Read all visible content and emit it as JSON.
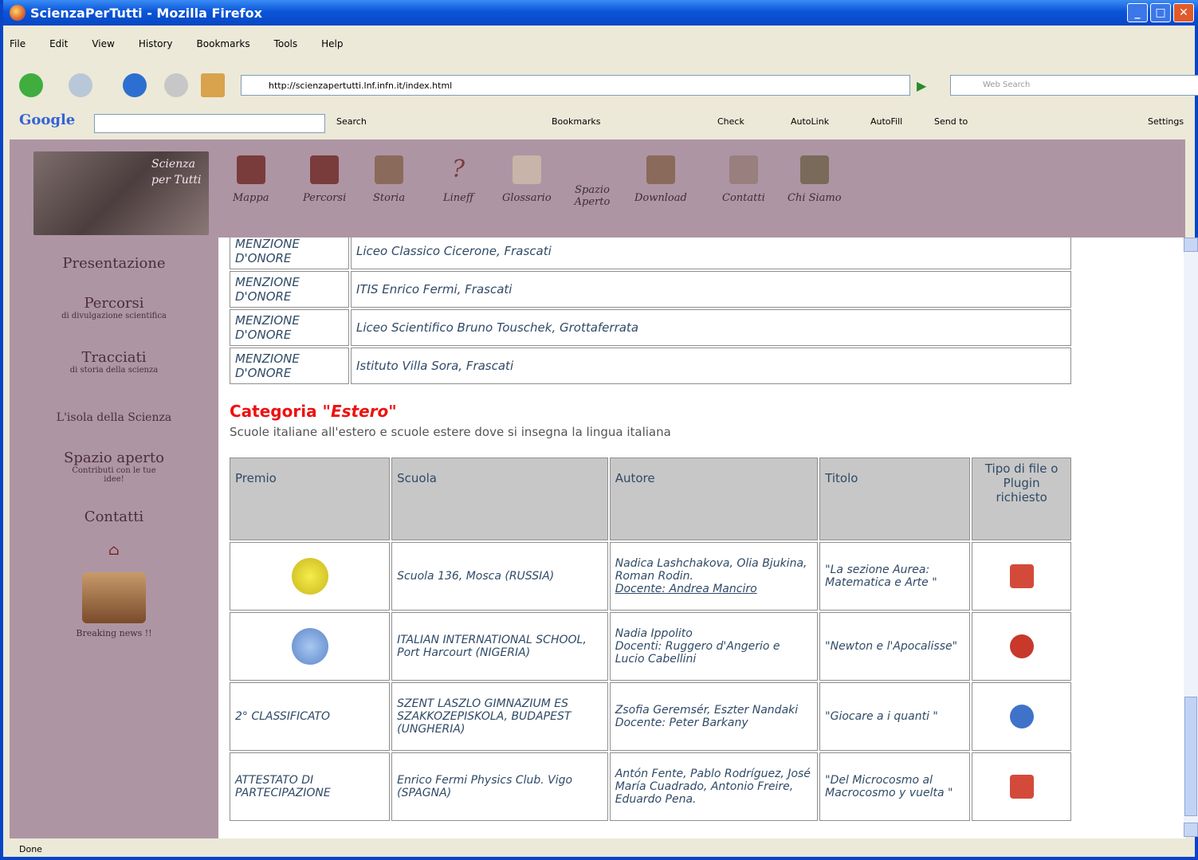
{
  "window": {
    "title": "ScienzaPerTutti - Mozilla Firefox"
  },
  "menu": [
    "File",
    "Edit",
    "View",
    "History",
    "Bookmarks",
    "Tools",
    "Help"
  ],
  "navbar": {
    "url": "http://scienzapertutti.lnf.infn.it/index.html",
    "search_placeholder": "Web Search"
  },
  "google_toolbar": {
    "logo": "Google",
    "search": "Search",
    "bookmarks": "Bookmarks",
    "check": "Check",
    "autolink": "AutoLink",
    "autofill": "AutoFill",
    "sendto": "Send to",
    "settings": "Settings"
  },
  "banner": {
    "logo_text_1": "Scienza",
    "logo_text_2": "per Tutti",
    "nav": [
      "Mappa",
      "Percorsi",
      "Storia",
      "Lineff",
      "Glossario",
      "Spazio Aperto",
      "Download",
      "Contatti",
      "Chi Siamo"
    ]
  },
  "sidebar": {
    "presentazione": "Presentazione",
    "percorsi": "Percorsi",
    "percorsi_sub": "di divulgazione scientifica",
    "tracciati": "Tracciati",
    "tracciati_sub": "di storia della scienza",
    "isola": "L'isola della Scienza",
    "spazio": "Spazio aperto",
    "spazio_sub": "Contributi con le tue idee!",
    "contatti": "Contatti",
    "breaking": "Breaking news !!"
  },
  "table1": [
    {
      "premio": "MENZIONE D'ONORE",
      "scuola": "Liceo Classico Cicerone, Frascati"
    },
    {
      "premio": "MENZIONE D'ONORE",
      "scuola": "ITIS Enrico Fermi, Frascati"
    },
    {
      "premio": "MENZIONE D'ONORE",
      "scuola": "Liceo Scientifico Bruno Touschek, Grottaferrata"
    },
    {
      "premio": "MENZIONE D'ONORE",
      "scuola": "Istituto Villa Sora, Frascati"
    }
  ],
  "category": {
    "title_prefix": "Categoria ",
    "title_quoted": "\"Estero\"",
    "subtitle": "Scuole italiane all'estero e scuole estere dove si insegna la lingua italiana"
  },
  "table2": {
    "headers": [
      "Premio",
      "Scuola",
      "Autore",
      "Titolo",
      "Tipo di file o Plugin richiesto"
    ],
    "rows": [
      {
        "premio": "",
        "scuola": "Scuola 136, Mosca (RUSSIA)",
        "autore": "Nadica Lashchakova, Olia Bjukina, Roman Rodin.",
        "docente": "Docente: Andrea Manciro",
        "titolo": "\"La sezione Aurea: Matematica e Arte \"",
        "file": "pdf"
      },
      {
        "premio": "",
        "scuola": "ITALIAN INTERNATIONAL SCHOOL, Port Harcourt (NIGERIA)",
        "autore": "Nadia Ippolito",
        "docente": "Docenti: Ruggero d'Angerio e Lucio Cabellini",
        "titolo": "\"Newton e l'Apocalisse\"",
        "file": "flash"
      },
      {
        "premio": "2° CLASSIFICATO",
        "scuola": "SZENT LASZLO GIMNAZIUM ES SZAKKOZEPISKOLA, BUDAPEST (UNGHERIA)",
        "autore": "Zsofia Geremsér, Eszter Nandaki",
        "docente": "Docente: Peter Barkany",
        "titolo": "\"Giocare a i quanti \"",
        "file": "ie"
      },
      {
        "premio": "ATTESTATO DI PARTECIPAZIONE",
        "scuola": "Enrico Fermi Physics Club. Vigo (SPAGNA)",
        "autore": "Antón Fente, Pablo Rodríguez, José María Cuadrado, Antonio Freire, Eduardo Pena.",
        "docente": "",
        "titolo": "\"Del Microcosmo al Macrocosmo y vuelta \"",
        "file": "pdf"
      }
    ]
  },
  "status": "Done"
}
